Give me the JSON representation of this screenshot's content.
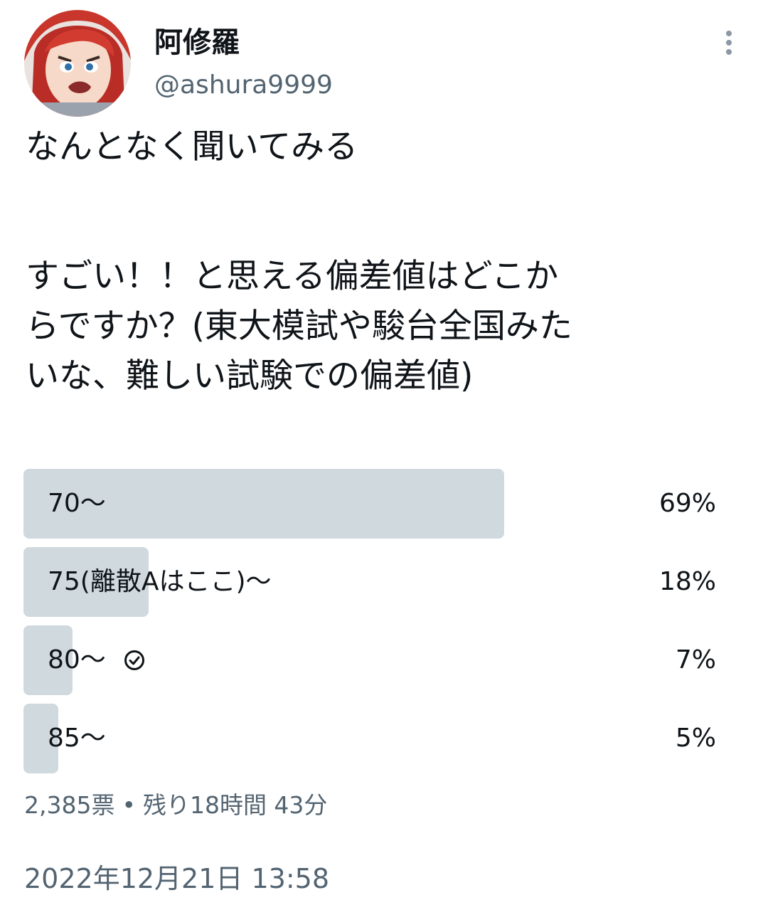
{
  "author": {
    "display_name": "阿修羅",
    "handle": "@ashura9999",
    "avatar_icon": "anime-avatar-icon"
  },
  "tweet": {
    "line1": "なんとなく聞いてみる",
    "line2": "すごい！！と思える偏差値はどこか",
    "line3": "らですか？(東大模試や駿台全国みた",
    "line4": "いな、難しい試験での偏差値)"
  },
  "poll": {
    "options": [
      {
        "label": "70〜",
        "percent": "69%",
        "value": 69,
        "voted": false
      },
      {
        "label": "75(離散Aはここ)〜",
        "percent": "18%",
        "value": 18,
        "voted": false
      },
      {
        "label": "80〜",
        "percent": "7%",
        "value": 7,
        "voted": true
      },
      {
        "label": "85〜",
        "percent": "5%",
        "value": 5,
        "voted": false
      }
    ],
    "votes": "2,385票",
    "separator": "•",
    "remaining": "残り18時間 43分"
  },
  "timestamp": "2022年12月21日 13:58",
  "colors": {
    "bar": "#cfd9de",
    "text": "#0f1419",
    "secondary": "#536471"
  }
}
